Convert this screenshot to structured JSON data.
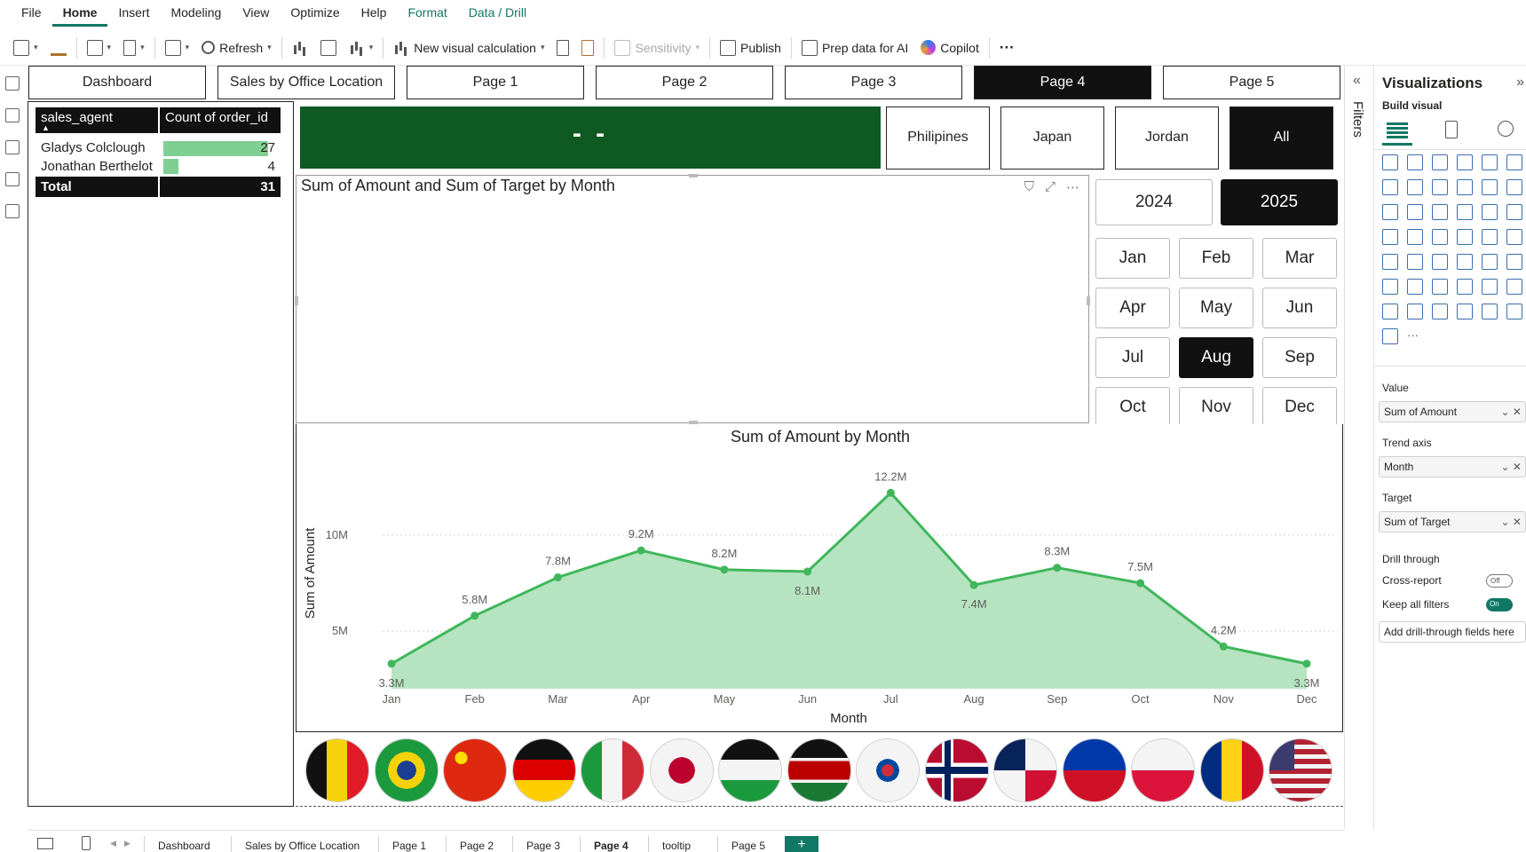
{
  "menu": [
    "File",
    "Home",
    "Insert",
    "Modeling",
    "View",
    "Optimize",
    "Help",
    "Format",
    "Data / Drill"
  ],
  "menu_active": "Home",
  "ribbon": {
    "refresh": "Refresh",
    "new_visual_calc": "New visual calculation",
    "sensitivity": "Sensitivity",
    "publish": "Publish",
    "prep_data": "Prep data for AI",
    "copilot": "Copilot",
    "more": "···"
  },
  "page_tabs": [
    "Dashboard",
    "Sales by Office Location",
    "Page 1",
    "Page 2",
    "Page 3",
    "Page 4",
    "Page 5"
  ],
  "active_page": "Page 4",
  "agent_table": {
    "headers": [
      "sales_agent",
      "Count of order_id"
    ],
    "rows": [
      {
        "agent": "Gladys Colclough",
        "count": "27",
        "fraction": 1.0
      },
      {
        "agent": "Jonathan Berthelot",
        "count": "4",
        "fraction": 0.148
      }
    ],
    "total_label": "Total",
    "total_value": "31"
  },
  "banner_text": "- -",
  "countries": [
    "Philipines",
    "Japan",
    "Jordan",
    "All"
  ],
  "active_country": "All",
  "years": [
    "2024",
    "2025"
  ],
  "active_year": "2025",
  "months": [
    "Jan",
    "Feb",
    "Mar",
    "Apr",
    "May",
    "Jun",
    "Jul",
    "Aug",
    "Sep",
    "Oct",
    "Nov",
    "Dec"
  ],
  "active_month": "Aug",
  "empty_visual": {
    "title": "Sum of Amount and Sum of Target by Month"
  },
  "chart_data": {
    "type": "area",
    "title": "Sum of Amount by Month",
    "xlabel": "Month",
    "ylabel": "Sum of Amount",
    "categories": [
      "Jan",
      "Feb",
      "Mar",
      "Apr",
      "May",
      "Jun",
      "Jul",
      "Aug",
      "Sep",
      "Oct",
      "Nov",
      "Dec"
    ],
    "values": [
      3.3,
      5.8,
      7.8,
      9.2,
      8.2,
      8.1,
      12.2,
      7.4,
      8.3,
      7.5,
      4.2,
      3.3
    ],
    "data_labels": [
      "3.3M",
      "5.8M",
      "7.8M",
      "9.2M",
      "8.2M",
      "8.1M",
      "12.2M",
      "7.4M",
      "8.3M",
      "7.5M",
      "4.2M",
      "3.3M"
    ],
    "ylim": [
      2,
      13
    ],
    "yticks": [
      {
        "value": 5,
        "label": "5M"
      },
      {
        "value": 10,
        "label": "10M"
      }
    ],
    "grid": true,
    "line_color": "#3fb75a",
    "fill_color": "#b6e3c0"
  },
  "flags": [
    "belgium-flag",
    "brazil-flag",
    "china-flag",
    "germany-flag",
    "italy-flag",
    "japan-flag",
    "jordan-flag",
    "kenya-flag",
    "south-korea-flag",
    "norway-flag",
    "panama-flag",
    "philippines-flag",
    "poland-flag",
    "romania-flag",
    "usa-flag"
  ],
  "bottom_tabs": [
    "Dashboard",
    "Sales by Office Location",
    "Page 1",
    "Page 2",
    "Page 3",
    "Page 4",
    "tooltip",
    "Page 5"
  ],
  "add_page": "+",
  "filters_label": "Filters",
  "viz_pane": {
    "title": "Visualizations",
    "build_visual": "Build visual",
    "value_label": "Value",
    "value_field": "Sum of Amount",
    "trend_label": "Trend axis",
    "trend_field": "Month",
    "target_label": "Target",
    "target_field": "Sum of Target",
    "drill_through": "Drill through",
    "cross_report": "Cross-report",
    "cross_report_state": "Off",
    "keep_filters": "Keep all filters",
    "keep_filters_state": "On",
    "add_drill": "Add drill-through fields here"
  },
  "colors": {
    "accent": "#117865",
    "banner": "#0f5a22",
    "bar": "#7fcf95"
  }
}
